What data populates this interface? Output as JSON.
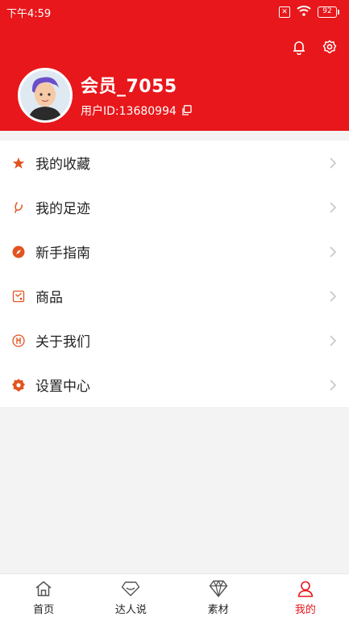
{
  "status_bar": {
    "time": "下午4:59",
    "sim_icon": "sim-off-icon",
    "wifi_icon": "wifi-icon",
    "battery": "92"
  },
  "header": {
    "bg_color": "#e8171b",
    "actions": [
      {
        "icon": "bell-icon"
      },
      {
        "icon": "gear-icon"
      }
    ]
  },
  "profile": {
    "username": "会员_7055",
    "user_id": "用户ID:13680994",
    "copy_icon": "copy-icon"
  },
  "menu": {
    "items": [
      {
        "label": "我的收藏",
        "icon": "star-icon"
      },
      {
        "label": "我的足迹",
        "icon": "footprint-icon"
      },
      {
        "label": "新手指南",
        "icon": "compass-icon"
      },
      {
        "label": "商品",
        "icon": "product-icon"
      },
      {
        "label": "关于我们",
        "icon": "about-icon"
      },
      {
        "label": "设置中心",
        "icon": "settings-icon"
      }
    ],
    "icon_color": "#e2531f"
  },
  "tabs": [
    {
      "label": "首页",
      "icon": "home-icon"
    },
    {
      "label": "达人说",
      "icon": "diamond-outline-icon"
    },
    {
      "label": "素材",
      "icon": "gem-icon"
    },
    {
      "label": "我的",
      "icon": "user-icon",
      "active": true
    }
  ]
}
